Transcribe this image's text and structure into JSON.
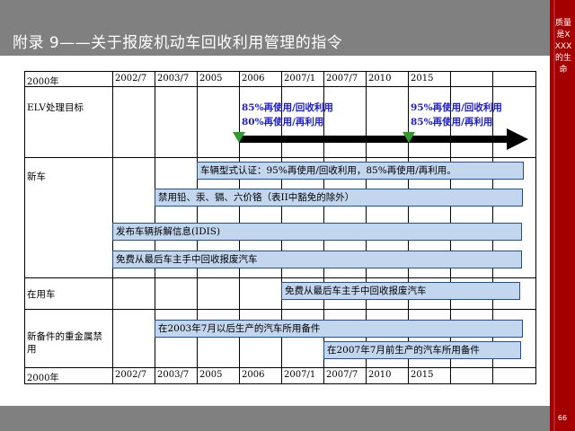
{
  "title": "附录 9——关于报废机动车回收利用管理的指令",
  "side_text": "质量是XXXX的生命",
  "page_number": "66",
  "years": [
    "2000年",
    "2002/7",
    "2003/7",
    "2005",
    "2006",
    "2007/1",
    "2007/7",
    "2010",
    "2015"
  ],
  "rows": {
    "elv": "ELV处理目标",
    "new_car": "新车",
    "used_car": "在用车",
    "spare_parts": "新备件的重金属禁用"
  },
  "targets": {
    "t2006_line1": "85%再使用/回收利用",
    "t2006_line2": "80%再使用/再利用",
    "t2015_line1": "95%再使用/回收利用",
    "t2015_line2": "85%再使用/再利用"
  },
  "bars": {
    "type_approval": "车辆型式认证：95%再使用/回收利用，85%再使用/再利用。",
    "heavy_metal_ban": "禁用铅、汞、镉、六价铬（表II中豁免的除外）",
    "idis": "发布车辆拆解信息(IDIS)",
    "free_takeback_new": "免费从最后车主手中回收报废汽车",
    "free_takeback_used": "免费从最后车主手中回收报废汽车",
    "after_2003": "在2003年7月以后生产的汽车所用备件",
    "before_2007": "在2007年7月前生产的汽车所用备件"
  },
  "colors": {
    "header_gray": "#808080",
    "side_red": "#a50000",
    "bar_fill": "#c2d6ee",
    "bar_border": "#1f4e96",
    "target_text": "#1c1ccd",
    "milestone_green": "#2d9e2d"
  }
}
